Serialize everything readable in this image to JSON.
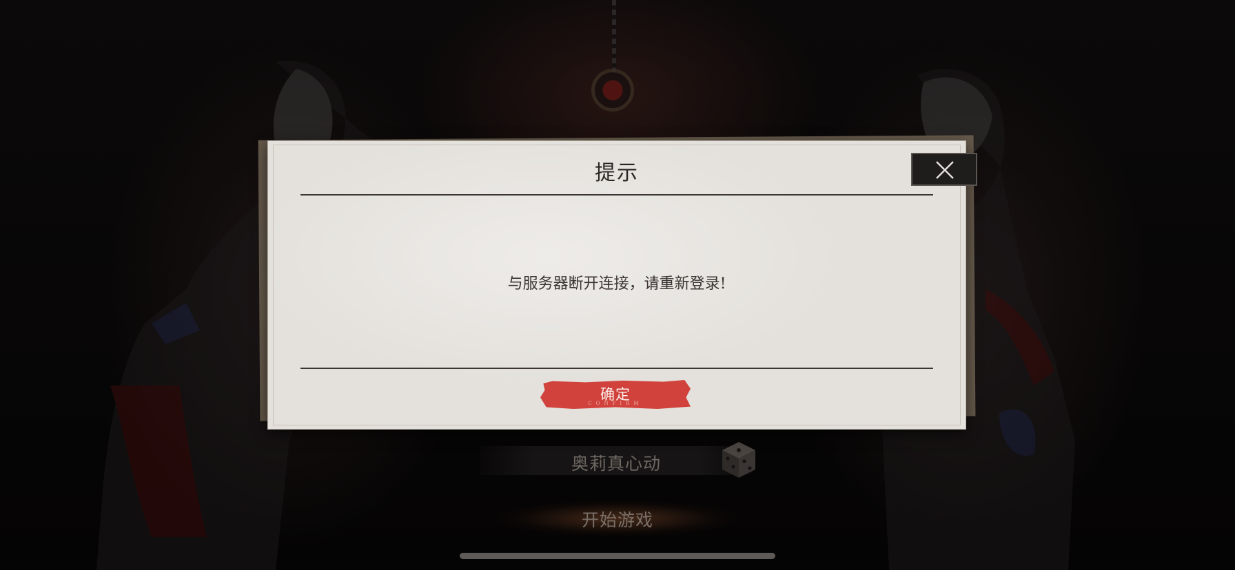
{
  "dialog": {
    "title": "提示",
    "message": "与服务器断开连接，请重新登录!",
    "confirm_label": "确定",
    "confirm_sub": "CONFIRM",
    "close_icon": "close-icon"
  },
  "background_menu": {
    "character_name": "奥莉真心动",
    "dice_icon": "dice-icon",
    "start_label": "开始游戏"
  },
  "colors": {
    "confirm": "#d0423b",
    "dialog_bg": "#e6e3de",
    "backdrop": "#070606"
  }
}
